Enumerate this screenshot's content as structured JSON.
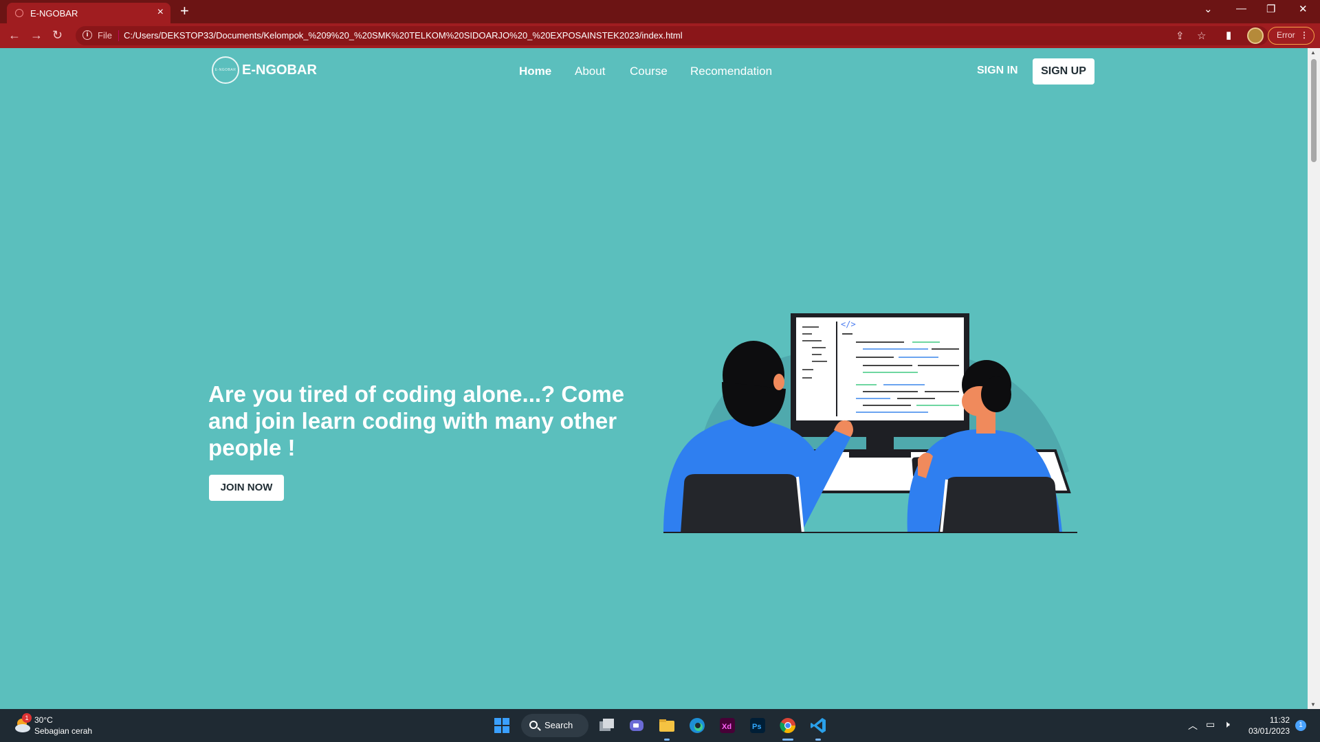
{
  "browser": {
    "tab_title": "E-NGOBAR",
    "tab_close": "×",
    "new_tab": "+",
    "url_scheme_label": "File",
    "url": "C:/Users/DEKSTOP33/Documents/Kelompok_%209%20_%20SMK%20TELKOM%20SIDOARJO%20_%20EXPOSAINSTEK2023/index.html",
    "error_label": "Error",
    "menu_dots": "⋮",
    "icons": [
      "back-icon",
      "forward-icon",
      "reload-icon",
      "info-icon",
      "share-icon",
      "bookmark-star-icon",
      "side-panel-icon",
      "profile-avatar"
    ]
  },
  "site": {
    "logo_text": "E-NGOBAR",
    "logo_mark_text": "E-NGOBAR",
    "nav": [
      {
        "label": "Home",
        "active": true
      },
      {
        "label": "About",
        "active": false
      },
      {
        "label": "Course",
        "active": false
      },
      {
        "label": "Recomendation",
        "active": false
      }
    ],
    "sign_in": "SIGN IN",
    "sign_up": "SIGN UP",
    "hero_title": "Are you tired of coding alone...? Come and join learn coding with many other people !",
    "join_button": "JOIN NOW",
    "illustration_code_tag": "</>"
  },
  "taskbar": {
    "weather_temp": "30°C",
    "weather_condition": "Sebagian cerah",
    "weather_badge": "1",
    "search_label": "Search",
    "apps": [
      "windows-start",
      "search",
      "task-view",
      "teams",
      "file-explorer",
      "edge",
      "adobe-xd",
      "photoshop",
      "chrome",
      "vscode"
    ],
    "xd_label": "Xd",
    "ps_label": "Ps",
    "time": "11:32",
    "date": "03/01/2023",
    "notification_count": "1"
  },
  "colors": {
    "page_bg": "#5bbfbd",
    "browser_frame": "#a01d20",
    "tab_strip": "#6c1414",
    "taskbar": "#1f2a33",
    "person_shirt": "#2f7ff0"
  }
}
